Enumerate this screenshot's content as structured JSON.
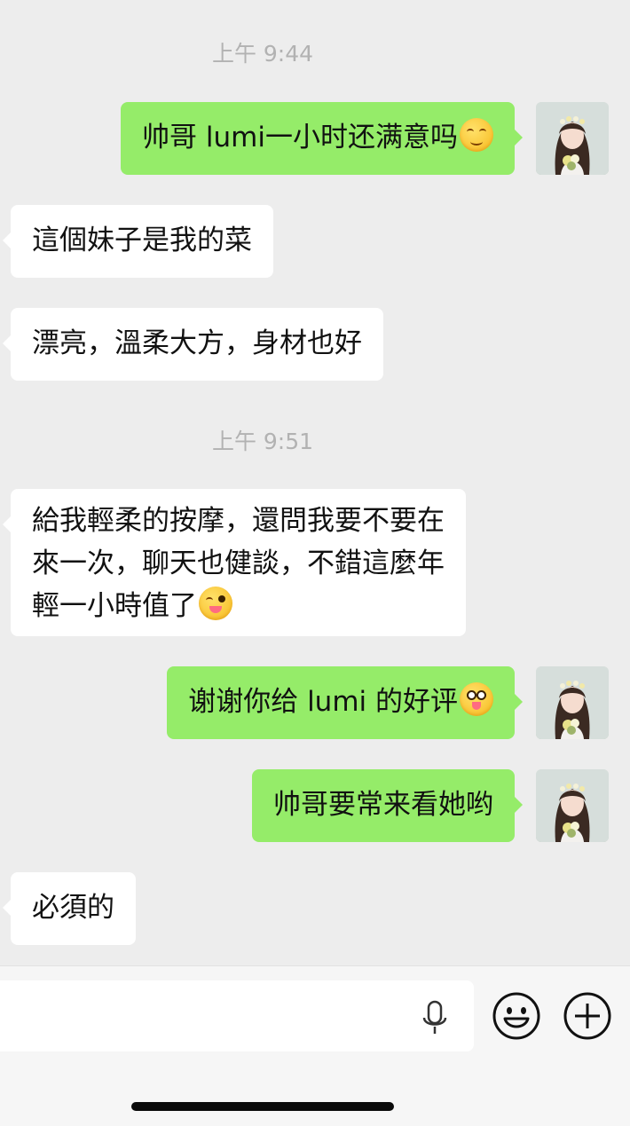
{
  "chat": {
    "timestamps": [
      "上午 9:44",
      "上午 9:51"
    ],
    "messages": [
      {
        "side": "out",
        "text": "帅哥 lumi一小时还满意吗",
        "emoji": "smile-squint-emoji"
      },
      {
        "side": "in",
        "text": "這個妹子是我的菜"
      },
      {
        "side": "in",
        "text": "漂亮，溫柔大方，身材也好"
      },
      {
        "side": "in",
        "lines": [
          "給我輕柔的按摩，還問我要不要在",
          "來一次，聊天也健談，不錯這麼年",
          "輕一小時值了"
        ],
        "emoji": "wink-tongue-emoji"
      },
      {
        "side": "out",
        "text": "谢谢你给 lumi 的好评",
        "emoji": "zany-face-emoji"
      },
      {
        "side": "out",
        "text": "帅哥要常来看她哟"
      },
      {
        "side": "in",
        "text": "必須的"
      }
    ]
  },
  "input_bar": {
    "placeholder": "",
    "icons": [
      "microphone-icon",
      "emoji-face-icon",
      "plus-circle-icon"
    ]
  },
  "colors": {
    "background": "#ededed",
    "outgoing_bubble": "#95ec69",
    "incoming_bubble": "#ffffff",
    "timestamp": "#b2b2b2"
  }
}
